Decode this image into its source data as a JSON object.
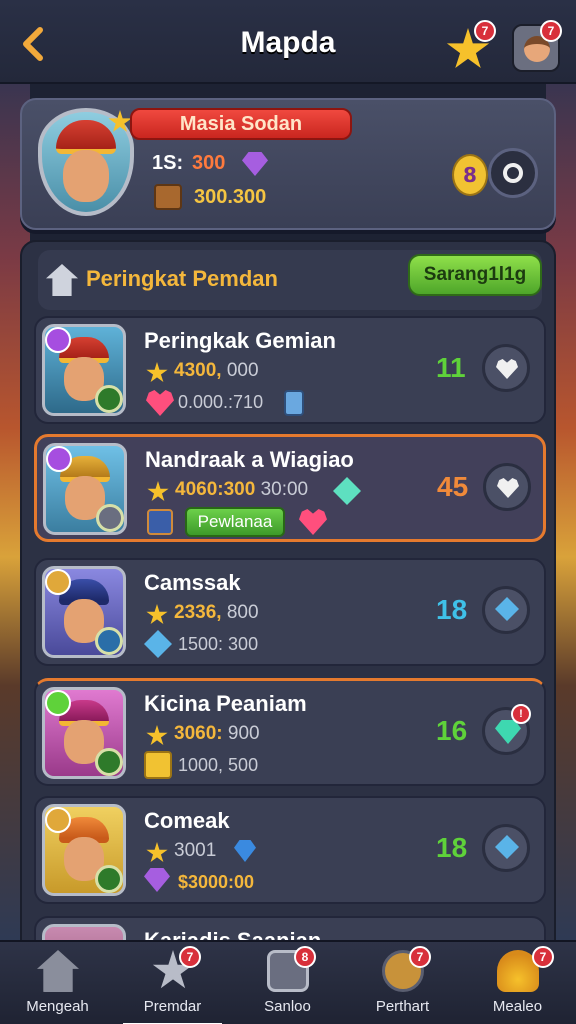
{
  "header": {
    "title": "Mapda",
    "back_icon": "chevron-left-icon",
    "star_badge": "7",
    "profile_badge": "7"
  },
  "profile": {
    "name": "Masia Sodan",
    "level": "1S:",
    "points": "300",
    "coins": "300.300",
    "gold_button_label": "8"
  },
  "section": {
    "title": "Peringkat Pemdan",
    "button_label": "Sarang1l1g"
  },
  "rows": [
    {
      "name": "Peringkak Gemian",
      "score": "4300,",
      "score2": "000",
      "sub": "0.000.:710",
      "rank": "11",
      "rank_color": "#5fd23a"
    },
    {
      "name": "Nandraak a Wiagiao",
      "score": "4060:300",
      "score2": "30:00",
      "tag": "Pewlanaa",
      "rank": "45",
      "rank_color": "#f08a3a"
    },
    {
      "name": "Camssak",
      "score": "2336,",
      "score2": "800",
      "sub": "1500: 300",
      "rank": "18",
      "rank_color": "#3fc1e8"
    },
    {
      "name": "Kicina Peaniam",
      "score": "3060:",
      "score2": "900",
      "sub": "1000, 500",
      "rank": "16",
      "rank_color": "#5fd23a"
    },
    {
      "name": "Comeak",
      "score": "3001",
      "score2": "",
      "sub": "$3000:00",
      "rank": "18",
      "rank_color": "#5fd23a"
    },
    {
      "name": "Kariadis Saanian",
      "score": "",
      "score2": "",
      "sub": "",
      "rank": "",
      "rank_color": "#ffffff"
    }
  ],
  "nav": [
    {
      "label": "Mengeah",
      "icon": "home-icon",
      "badge": ""
    },
    {
      "label": "Premdar",
      "icon": "star-burst-icon",
      "badge": "7"
    },
    {
      "label": "Sanloo",
      "icon": "dice-icon",
      "badge": "8"
    },
    {
      "label": "Perthart",
      "icon": "chest-icon",
      "badge": "7"
    },
    {
      "label": "Mealeo",
      "icon": "gold-pile-icon",
      "badge": "7"
    }
  ]
}
